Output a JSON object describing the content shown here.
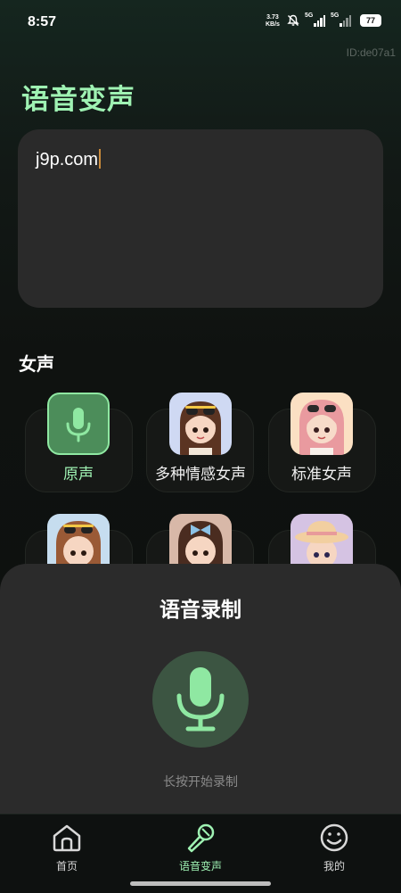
{
  "status_bar": {
    "time": "8:57",
    "net_speed_value": "3.73",
    "net_speed_unit": "KB/s",
    "signal_1_label": "5G",
    "signal_2_label": "5G",
    "battery": "77"
  },
  "device_id": "ID:de07a1",
  "page_title": "语音变声",
  "text_input": {
    "value": "j9p.com"
  },
  "section_title": "女声",
  "voices": [
    {
      "label": "原声",
      "icon": "mic-icon",
      "selected": true
    },
    {
      "label": "多种情感女声",
      "icon": "avatar-girl-sunglasses",
      "selected": false
    },
    {
      "label": "标准女声",
      "icon": "avatar-girl-pink-hair",
      "selected": false
    },
    {
      "label": "",
      "icon": "avatar-girl-sunglasses-2",
      "selected": false
    },
    {
      "label": "",
      "icon": "avatar-girl-bow",
      "selected": false
    },
    {
      "label": "",
      "icon": "avatar-girl-hat",
      "selected": false
    }
  ],
  "record_sheet": {
    "title": "语音录制",
    "hint": "长按开始录制",
    "accent": "#8fe8a2"
  },
  "nav": {
    "items": [
      {
        "label": "首页",
        "icon": "home-icon",
        "active": false
      },
      {
        "label": "语音变声",
        "icon": "mic-nav-icon",
        "active": true
      },
      {
        "label": "我的",
        "icon": "smile-icon",
        "active": false
      }
    ]
  },
  "colors": {
    "accent": "#9ff2b3",
    "card_bg": "#2a2a2a",
    "sheet_bg": "#2b2b2b"
  }
}
